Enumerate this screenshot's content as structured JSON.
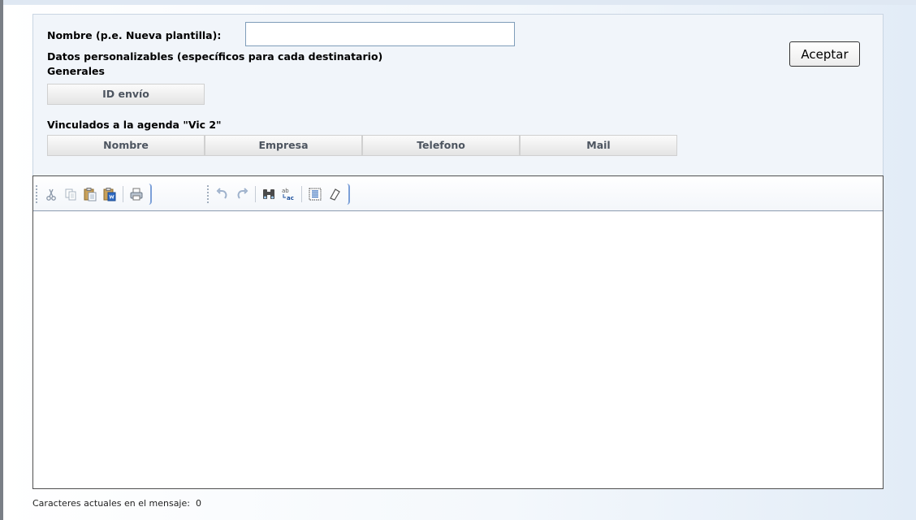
{
  "form": {
    "name_label": "Nombre (p.e. Nueva plantilla):",
    "name_value": "",
    "custom_data_title": "Datos personalizables (específicos para cada destinatario)",
    "general_title": "Generales",
    "general_fields": [
      "ID envío"
    ],
    "agenda_title": "Vinculados a la agenda \"Vic 2\"",
    "agenda_fields": [
      "Nombre",
      "Empresa",
      "Telefono",
      "Mail"
    ],
    "accept_label": "Aceptar"
  },
  "toolbar": {
    "icons": [
      "cut-icon",
      "copy-icon",
      "paste-icon",
      "paste-word-icon",
      "print-icon",
      "undo-icon",
      "redo-icon",
      "find-icon",
      "replace-icon",
      "select-all-icon",
      "remove-format-icon"
    ]
  },
  "status": {
    "char_count_label": "Caracteres actuales en el mensaje:",
    "char_count": "0"
  }
}
